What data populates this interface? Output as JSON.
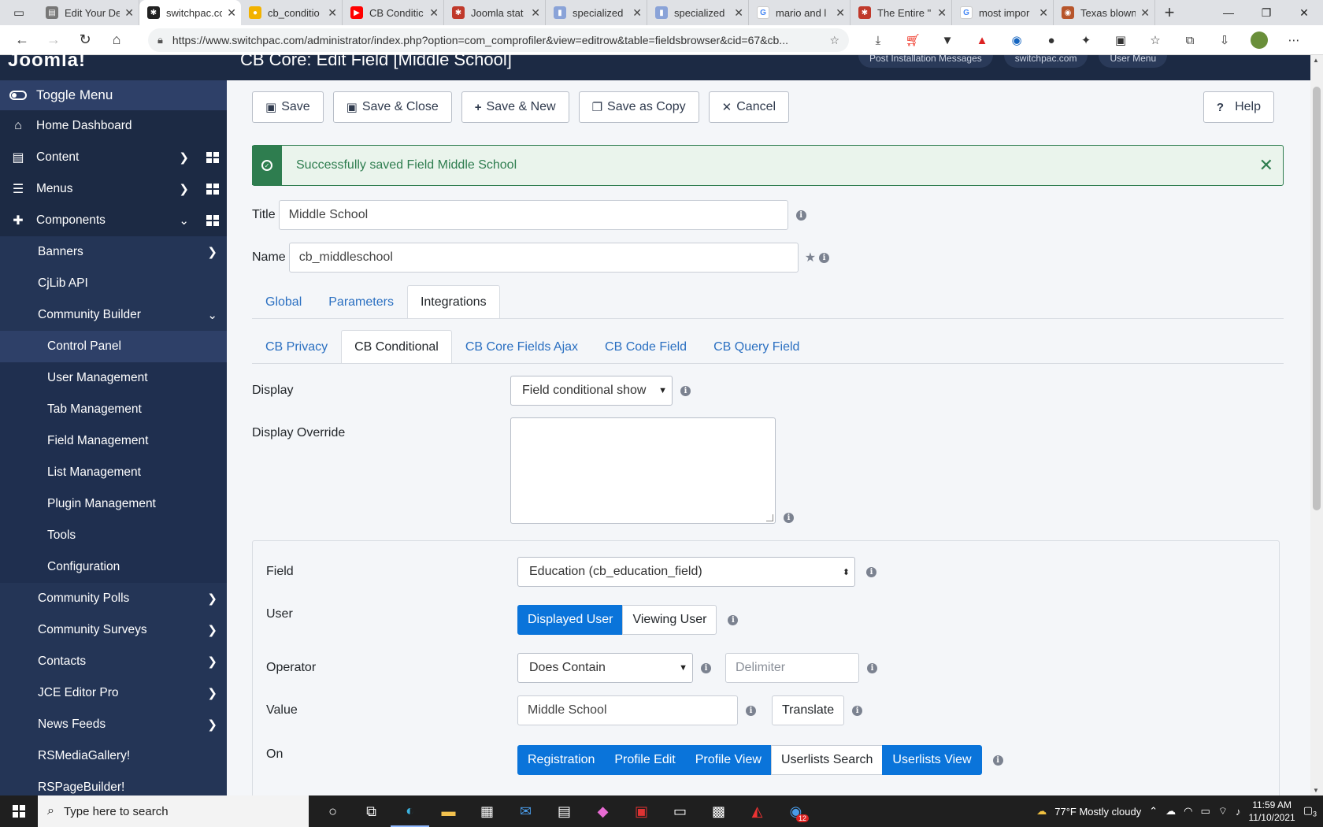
{
  "browser": {
    "tabs": [
      {
        "title": "Edit Your De",
        "icon": "document-icon",
        "color": "#555555"
      },
      {
        "title": "switchpac.co",
        "icon": "joomla-icon",
        "color": "#222222",
        "active": true
      },
      {
        "title": "cb_conditio",
        "icon": "chat-icon",
        "color": "#f2b200"
      },
      {
        "title": "CB Conditic",
        "icon": "youtube-icon",
        "color": "#ff0000"
      },
      {
        "title": "Joomla stat",
        "icon": "joomla-icon",
        "color": "#c0392b"
      },
      {
        "title": "specialized",
        "icon": "bag-icon",
        "color": "#8aa3d8"
      },
      {
        "title": "specialized",
        "icon": "bag-icon",
        "color": "#8aa3d8"
      },
      {
        "title": "mario and l",
        "icon": "google-icon",
        "color": "#4285f4"
      },
      {
        "title": "The Entire \"",
        "icon": "joomla-icon",
        "color": "#c0392b"
      },
      {
        "title": "most impor",
        "icon": "google-icon",
        "color": "#4285f4"
      },
      {
        "title": "Texas blown",
        "icon": "news-icon",
        "color": "#b7552b"
      }
    ],
    "url": "https://www.switchpac.com/administrator/index.php?option=com_comprofiler&view=editrow&table=fieldsbrowser&cid=67&cb..."
  },
  "header": {
    "logo": "Joomla!",
    "page_title": "CB Core: Edit Field [Middle School]",
    "buttons": [
      "Post Installation Messages",
      "switchpac.com",
      "User Menu"
    ]
  },
  "sidebar": {
    "toggle_label": "Toggle Menu",
    "items": [
      {
        "label": "Home Dashboard",
        "level": 1,
        "icon": "home-icon"
      },
      {
        "label": "Content",
        "level": 1,
        "icon": "file-icon",
        "chevron": "right",
        "grid": true
      },
      {
        "label": "Menus",
        "level": 1,
        "icon": "list-icon",
        "chevron": "right",
        "grid": true
      },
      {
        "label": "Components",
        "level": 1,
        "icon": "puzzle-icon",
        "chevron": "down",
        "grid": true
      },
      {
        "label": "Banners",
        "level": 2,
        "chevron": "right"
      },
      {
        "label": "CjLib API",
        "level": 2
      },
      {
        "label": "Community Builder",
        "level": 2,
        "chevron": "down"
      },
      {
        "label": "Control Panel",
        "level": 3,
        "current": true
      },
      {
        "label": "User Management",
        "level": 3
      },
      {
        "label": "Tab Management",
        "level": 3
      },
      {
        "label": "Field Management",
        "level": 3
      },
      {
        "label": "List Management",
        "level": 3
      },
      {
        "label": "Plugin Management",
        "level": 3
      },
      {
        "label": "Tools",
        "level": 3
      },
      {
        "label": "Configuration",
        "level": 3
      },
      {
        "label": "Community Polls",
        "level": 2,
        "chevron": "right"
      },
      {
        "label": "Community Surveys",
        "level": 2,
        "chevron": "right"
      },
      {
        "label": "Contacts",
        "level": 2,
        "chevron": "right"
      },
      {
        "label": "JCE Editor Pro",
        "level": 2,
        "chevron": "right"
      },
      {
        "label": "News Feeds",
        "level": 2,
        "chevron": "right"
      },
      {
        "label": "RSMediaGallery!",
        "level": 2
      },
      {
        "label": "RSPageBuilder!",
        "level": 2
      }
    ]
  },
  "toolbar": {
    "save": "Save",
    "save_close": "Save & Close",
    "save_new": "Save & New",
    "save_copy": "Save as Copy",
    "cancel": "Cancel",
    "help": "Help"
  },
  "alert": {
    "message": "Successfully saved Field Middle School"
  },
  "form": {
    "title_label": "Title",
    "title_value": "Middle School",
    "name_label": "Name",
    "name_value": "cb_middleschool",
    "main_tabs": [
      "Global",
      "Parameters",
      "Integrations"
    ],
    "sub_tabs": [
      "CB Privacy",
      "CB Conditional",
      "CB Core Fields Ajax",
      "CB Code Field",
      "CB Query Field"
    ],
    "display_label": "Display",
    "display_value": "Field conditional show",
    "display_override_label": "Display Override",
    "field_label": "Field",
    "field_value": "Education (cb_education_field)",
    "user_label": "User",
    "user_options": [
      "Displayed User",
      "Viewing User"
    ],
    "operator_label": "Operator",
    "operator_value": "Does Contain",
    "delimiter_placeholder": "Delimiter",
    "value_label": "Value",
    "value_value": "Middle School",
    "translate": "Translate",
    "on_label": "On",
    "on_options": [
      "Registration",
      "Profile Edit",
      "Profile View",
      "Userlists Search",
      "Userlists View"
    ]
  },
  "taskbar": {
    "search_placeholder": "Type here to search",
    "weather": "77°F  Mostly cloudy",
    "time": "11:59 AM",
    "date": "11/10/2021",
    "notifications": "3",
    "badge": "12"
  }
}
